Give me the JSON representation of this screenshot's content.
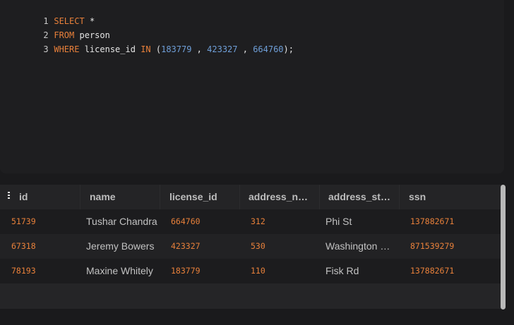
{
  "editor": {
    "lines": [
      {
        "number": "1",
        "tokens": [
          {
            "text": "SELECT",
            "kind": "kw"
          },
          {
            "text": " *",
            "kind": "id"
          }
        ]
      },
      {
        "number": "2",
        "tokens": [
          {
            "text": "FROM",
            "kind": "kw"
          },
          {
            "text": " person",
            "kind": "id"
          }
        ]
      },
      {
        "number": "3",
        "tokens": [
          {
            "text": "WHERE",
            "kind": "kw"
          },
          {
            "text": " license_id ",
            "kind": "id"
          },
          {
            "text": "IN",
            "kind": "kw"
          },
          {
            "text": " (",
            "kind": "punct"
          },
          {
            "text": "183779",
            "kind": "num"
          },
          {
            "text": " , ",
            "kind": "punct"
          },
          {
            "text": "423327",
            "kind": "num"
          },
          {
            "text": " , ",
            "kind": "punct"
          },
          {
            "text": "664760",
            "kind": "num"
          },
          {
            "text": ");",
            "kind": "punct"
          }
        ]
      }
    ]
  },
  "results": {
    "columns": [
      "id",
      "name",
      "license_id",
      "address_nu...",
      "address_str...",
      "ssn"
    ],
    "rows": [
      [
        "51739",
        "Tushar Chandra",
        "664760",
        "312",
        "Phi St",
        "137882671"
      ],
      [
        "67318",
        "Jeremy Bowers",
        "423327",
        "530",
        "Washington Pl...",
        "871539279"
      ],
      [
        "78193",
        "Maxine Whitely",
        "183779",
        "110",
        "Fisk Rd",
        "137882671"
      ]
    ],
    "numeric_columns": [
      0,
      2,
      3,
      5
    ]
  },
  "icons": {
    "column_menu": "vertical-dots-icon"
  },
  "colors": {
    "keyword": "#e8803a",
    "number_literal": "#6f9fd8",
    "numeric_cell": "#e8803a",
    "background": "#1a1a1c"
  }
}
